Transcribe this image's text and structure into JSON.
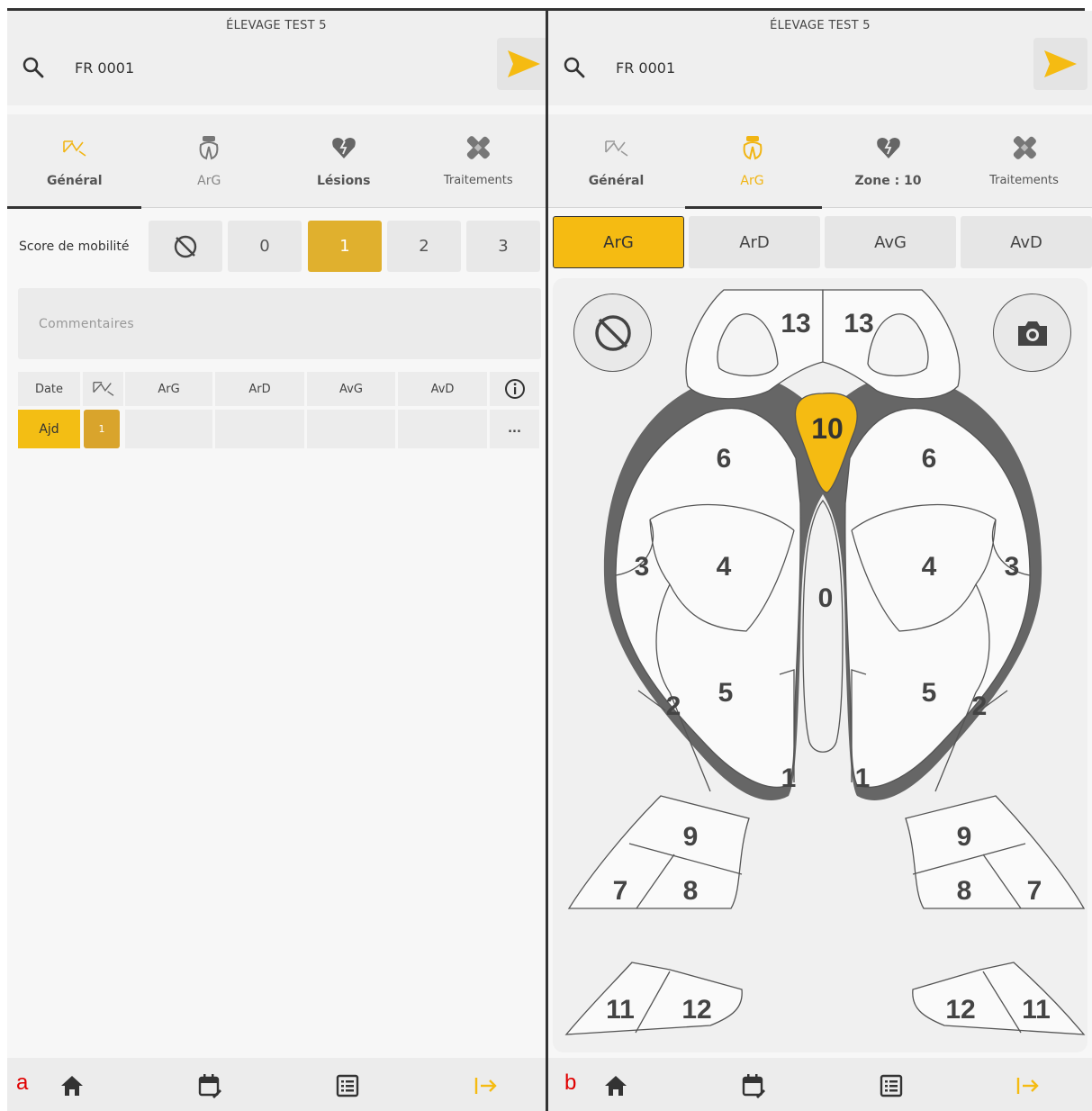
{
  "farm_name": "ÉLEVAGE TEST 5",
  "animal_id": "FR 0001",
  "panel_a": {
    "letter": "a",
    "tabs": [
      {
        "label": "Général",
        "icon": "mobility-icon",
        "active": true
      },
      {
        "label": "ArG",
        "icon": "hoof-icon"
      },
      {
        "label": "Lésions",
        "icon": "broken-heart-icon"
      },
      {
        "label": "Traitements",
        "icon": "bandage-icon"
      }
    ],
    "score_label": "Score de mobilité",
    "score_options": [
      "none",
      "0",
      "1",
      "2",
      "3"
    ],
    "score_selected": "1",
    "comments_placeholder": "Commentaires",
    "table": {
      "headers": [
        "Date",
        "mobility-icon",
        "ArG",
        "ArD",
        "AvG",
        "AvD",
        "info-icon"
      ],
      "rows": [
        {
          "date": "Ajd",
          "score": "1",
          "arg": "",
          "ard": "",
          "avg": "",
          "avd": "",
          "more": "..."
        }
      ]
    }
  },
  "panel_b": {
    "letter": "b",
    "tabs": [
      {
        "label": "Général",
        "icon": "mobility-icon"
      },
      {
        "label": "ArG",
        "icon": "hoof-icon",
        "active": true
      },
      {
        "label": "Zone : 10",
        "icon": "broken-heart-icon"
      },
      {
        "label": "Traitements",
        "icon": "bandage-icon"
      }
    ],
    "sides": [
      "ArG",
      "ArD",
      "AvG",
      "AvD"
    ],
    "side_selected": "ArG",
    "selected_zone": "10",
    "zone_labels": {
      "z13l": "13",
      "z13r": "13",
      "z10": "10",
      "z6l": "6",
      "z6r": "6",
      "z3l": "3",
      "z3r": "3",
      "z4l": "4",
      "z4r": "4",
      "z0": "0",
      "z5l": "5",
      "z5r": "5",
      "z2l": "2",
      "z2r": "2",
      "z1l": "1",
      "z1r": "1",
      "z9l": "9",
      "z9r": "9",
      "z7l": "7",
      "z7r": "7",
      "z8l": "8",
      "z8r": "8",
      "z11l": "11",
      "z11r": "11",
      "z12l": "12",
      "z12r": "12"
    }
  },
  "colors": {
    "accent": "#f5bb12",
    "accent_dark": "#e0b02e",
    "hoof_outline": "#666666",
    "panel_bg": "#f7f7f7"
  },
  "bottom_nav": [
    "home-icon",
    "calendar-edit-icon",
    "list-icon",
    "exit-icon"
  ]
}
